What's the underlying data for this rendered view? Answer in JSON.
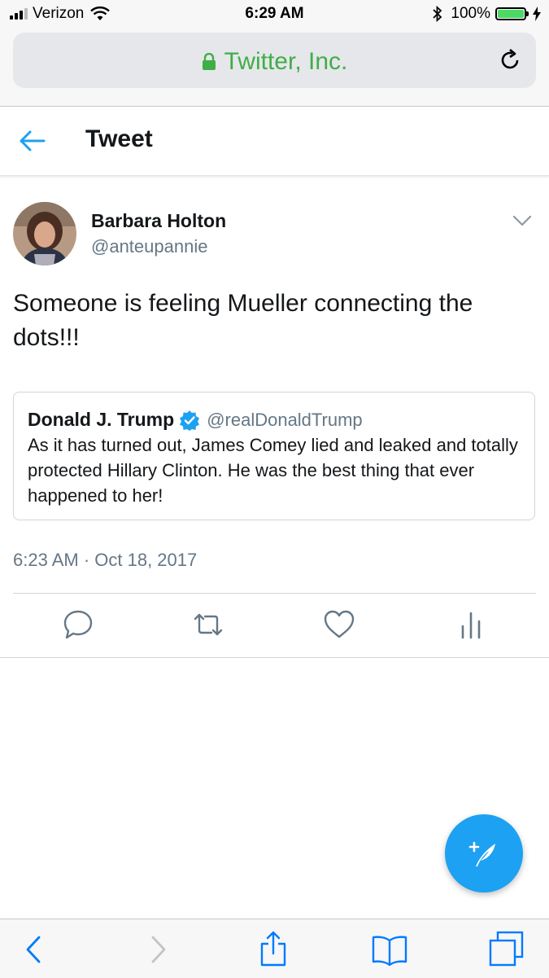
{
  "status_bar": {
    "carrier": "Verizon",
    "time": "6:29 AM",
    "battery": "100%"
  },
  "browser": {
    "site": "Twitter, Inc."
  },
  "header": {
    "title": "Tweet"
  },
  "tweet": {
    "author_name": "Barbara Holton",
    "author_handle": "@anteupannie",
    "text": "Someone is feeling Mueller connecting the dots!!!",
    "timestamp": "6:23 AM · Oct 18, 2017",
    "quoted": {
      "author_name": "Donald J. Trump",
      "author_handle": "@realDonaldTrump",
      "text": "As it has turned out, James Comey lied and leaked and totally protected Hillary Clinton. He was the best thing that ever happened to her!"
    }
  },
  "actions": [
    "reply-icon",
    "retweet-icon",
    "like-icon",
    "analytics-icon"
  ],
  "toolbar": [
    "back-icon",
    "forward-icon",
    "share-icon",
    "bookmarks-icon",
    "tabs-icon"
  ],
  "colors": {
    "accent": "#1da1f2",
    "secure_green": "#3fae49",
    "secondary_text": "#657786",
    "ios_blue": "#007aff"
  }
}
